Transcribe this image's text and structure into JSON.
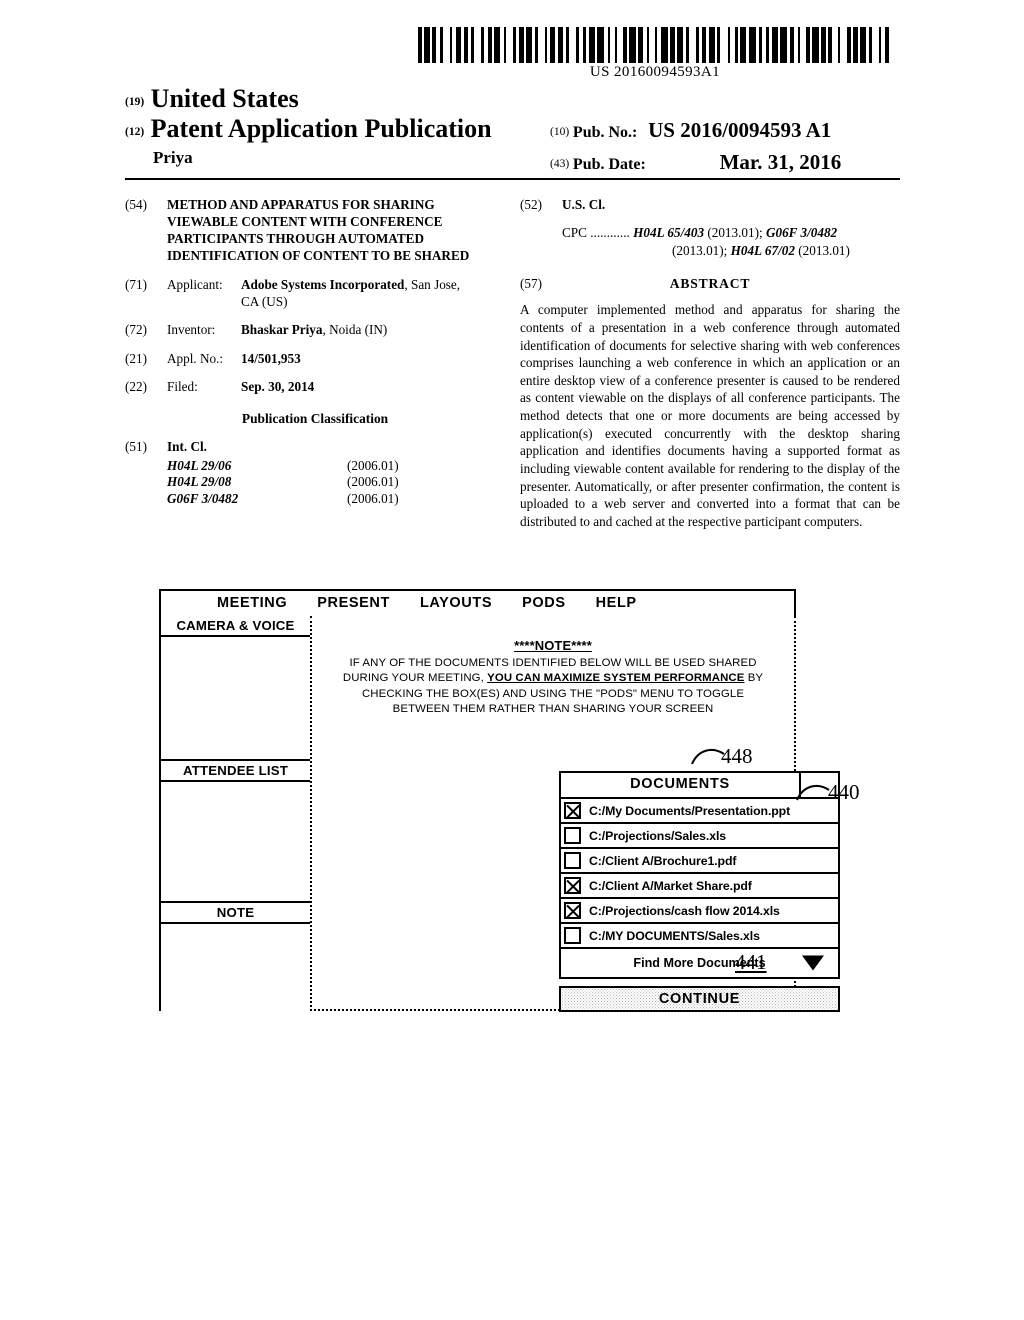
{
  "barcode": {
    "number": "US 20160094593A1",
    "widths": [
      3,
      2,
      5,
      2,
      3,
      4,
      2,
      6,
      2,
      3,
      5,
      2,
      4,
      2,
      3,
      6,
      2,
      4,
      3,
      2,
      5,
      3,
      2,
      6,
      3,
      2,
      4,
      2,
      5,
      3,
      2,
      6,
      2,
      3,
      4,
      2,
      5,
      2,
      3,
      6,
      2,
      4,
      2,
      3,
      5,
      2,
      6,
      3,
      2,
      4,
      2,
      5,
      3,
      2,
      6,
      2,
      4,
      3,
      2,
      5,
      2,
      3,
      6,
      2,
      4,
      2,
      5,
      3,
      2,
      6,
      3,
      2,
      4,
      2,
      5,
      2,
      3,
      6,
      2,
      4,
      3,
      2,
      5,
      2,
      6,
      3,
      2,
      4,
      2,
      3,
      5,
      2,
      6,
      2,
      4,
      3,
      2,
      5,
      3,
      2,
      6,
      2,
      4,
      2,
      3,
      5,
      2,
      6,
      3,
      2,
      4,
      2,
      5,
      3,
      2,
      6,
      2,
      3,
      4,
      2
    ]
  },
  "header": {
    "country_tag": "(19)",
    "country": "United States",
    "doc_type_tag": "(12)",
    "doc_type": "Patent Application Publication",
    "inventor_short": "Priya",
    "pubno_tag": "(10)",
    "pubno_label": "Pub. No.:",
    "pubno_value": "US 2016/0094593 A1",
    "pubdate_tag": "(43)",
    "pubdate_label": "Pub. Date:",
    "pubdate_value": "Mar. 31, 2016"
  },
  "left_column": {
    "title_tag": "(54)",
    "title": "METHOD AND APPARATUS FOR SHARING VIEWABLE CONTENT WITH CONFERENCE PARTICIPANTS THROUGH AUTOMATED IDENTIFICATION OF CONTENT TO BE SHARED",
    "applicant_tag": "(71)",
    "applicant_label": "Applicant:",
    "applicant_name": "Adobe Systems Incorporated",
    "applicant_location": ", San Jose, CA (US)",
    "inventor_tag": "(72)",
    "inventor_label": "Inventor:",
    "inventor_name": "Bhaskar Priya",
    "inventor_location": ", Noida (IN)",
    "applno_tag": "(21)",
    "applno_label": "Appl. No.:",
    "applno_value": "14/501,953",
    "filed_tag": "(22)",
    "filed_label": "Filed:",
    "filed_value": "Sep. 30, 2014",
    "pubclass_heading": "Publication Classification",
    "intcl_tag": "(51)",
    "intcl_label": "Int. Cl.",
    "intcl_rows": [
      {
        "code": "H04L 29/06",
        "version": "(2006.01)"
      },
      {
        "code": "H04L 29/08",
        "version": "(2006.01)"
      },
      {
        "code": "G06F 3/0482",
        "version": "(2006.01)"
      }
    ]
  },
  "right_column": {
    "uscl_tag": "(52)",
    "uscl_label": "U.S. Cl.",
    "cpc_prefix": "CPC ............",
    "cpc_line1_codes": [
      "H04L 65/403",
      "G06F 3/0482"
    ],
    "cpc_line1_text": " (2013.01); ",
    "cpc_line2": "(2013.01); ",
    "cpc_line2_code": "H04L 67/02",
    "cpc_line2_tail": " (2013.01)",
    "abstract_tag": "(57)",
    "abstract_heading": "ABSTRACT",
    "abstract_text": "A computer implemented method and apparatus for sharing the contents of a presentation in a web conference through automated identification of documents for selective sharing with web conferences comprises launching a web conference in which an application or an entire desktop view of a conference presenter is caused to be rendered as content viewable on the displays of all conference participants. The method detects that one or more documents are being accessed by application(s) executed concurrently with the desktop sharing application and identifies documents having a supported format as including viewable content available for rendering to the display of the presenter. Automatically, or after presenter confirmation, the content is uploaded to a web server and converted into a format that can be distributed to and cached at the respective participant computers."
  },
  "figure": {
    "menu_items": [
      "MEETING",
      "PRESENT",
      "LAYOUTS",
      "PODS",
      "HELP"
    ],
    "sidebar_panels": [
      {
        "title": "CAMERA & VOICE"
      },
      {
        "title": "ATTENDEE LIST"
      },
      {
        "title": "NOTE"
      }
    ],
    "note": {
      "title": "****NOTE****",
      "line1": "IF ANY OF THE DOCUMENTS IDENTIFIED BELOW WILL BE USED SHARED",
      "line2_pre": "DURING YOUR MEETING, ",
      "line2_emph": "YOU CAN MAXIMIZE SYSTEM PERFORMANCE",
      "line2_post": " BY",
      "line3": "CHECKING THE BOX(ES) AND USING THE \"PODS\" MENU TO TOGGLE",
      "line4": "BETWEEN THEM RATHER THAN SHARING YOUR SCREEN"
    },
    "documents_panel": {
      "header": "DOCUMENTS",
      "rows": [
        {
          "checked": true,
          "path": "C:/My Documents/Presentation.ppt"
        },
        {
          "checked": false,
          "path": "C:/Projections/Sales.xls"
        },
        {
          "checked": false,
          "path": "C:/Client A/Brochure1.pdf"
        },
        {
          "checked": true,
          "path": "C:/Client A/Market Share.pdf"
        },
        {
          "checked": true,
          "path": "C:/Projections/cash flow 2014.xls"
        },
        {
          "checked": false,
          "path": "C:/MY DOCUMENTS/Sales.xls"
        }
      ],
      "find_more_label": "Find More Documents",
      "caret_icon": "triangle-down-icon"
    },
    "continue_label": "CONTINUE",
    "ref_numerals": {
      "documents_panel": "448",
      "window": "440",
      "continue_area": "441"
    }
  }
}
